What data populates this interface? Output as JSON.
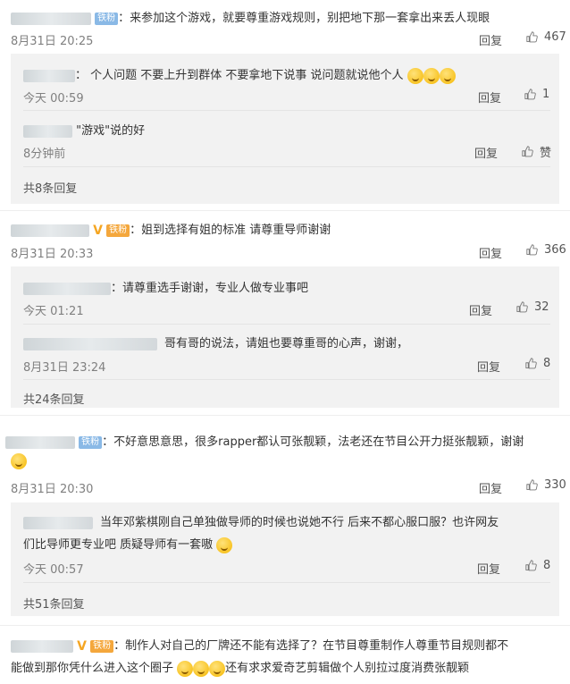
{
  "labels": {
    "reply": "回复",
    "like_zan": "赞"
  },
  "comments": [
    {
      "badge": "铁粉",
      "text": "：来参加这个游戏，就要尊重游戏规则，别把地下那一套拿出来丢人现眼",
      "time": "8月31日 20:25",
      "likes": "467",
      "replies": [
        {
          "text": "： 个人问题 不要上升到群体 不要拿地下说事 说问题就说他个人",
          "time": "今天 00:59",
          "likes": "1"
        },
        {
          "text": "\"游戏\"说的好",
          "time": "8分钟前",
          "likes": "赞"
        }
      ],
      "more": "共8条回复"
    },
    {
      "badge": "铁粉",
      "text": "：姐到选择有姐的标准 请尊重导师谢谢",
      "time": "8月31日 20:33",
      "likes": "366",
      "replies": [
        {
          "text": "：请尊重选手谢谢，专业人做专业事吧",
          "time": "今天 01:21",
          "likes": "32"
        },
        {
          "text": "哥有哥的说法，请姐也要尊重哥的心声，谢谢，",
          "time": "8月31日 23:24",
          "likes": "8"
        }
      ],
      "more": "共24条回复"
    },
    {
      "badge": "铁粉",
      "text": "：不好意思意思，很多rapper都认可张靓颖，法老还在节目公开力挺张靓颖，谢谢",
      "time": "8月31日 20:30",
      "likes": "330",
      "replies": [
        {
          "text1": "当年邓紫棋刚自己单独做导师的时候也说她不行 后来不都心服口服？也许网友",
          "text2": "们比导师更专业吧 质疑导师有一套嗷",
          "time": "今天 00:57",
          "likes": "8"
        }
      ],
      "more": "共51条回复"
    },
    {
      "badge": "铁粉",
      "text1": "：制作人对自己的厂牌还不能有选择了？在节目尊重制作人尊重节目规则都不",
      "text2": "能做到那你凭什么进入这个圈子",
      "text3": "还有求求爱奇艺剪辑做个人别拉过度消费张靓颖"
    }
  ]
}
